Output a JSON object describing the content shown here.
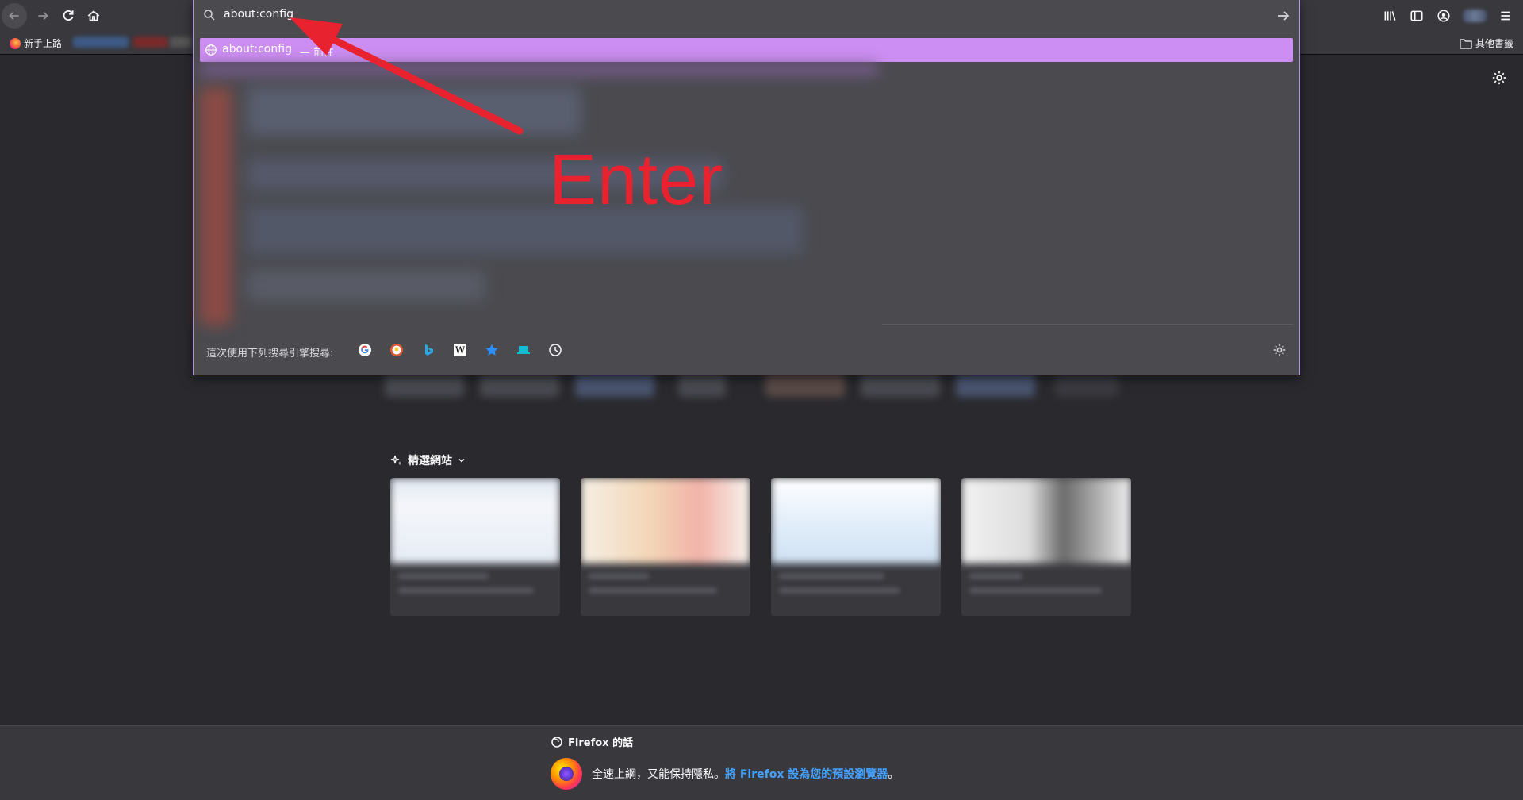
{
  "toolbar": {
    "back_icon": "back-arrow-icon",
    "forward_icon": "forward-arrow-icon",
    "reload_icon": "reload-icon",
    "home_icon": "home-icon",
    "right_icons": [
      "library-icon",
      "sidebar-icon",
      "account-icon",
      "avatar",
      "menu-icon"
    ]
  },
  "bookmarks": {
    "items": [
      {
        "label": "新手上路"
      }
    ],
    "other_label": "其他書籤"
  },
  "urlbar": {
    "value": "about:config",
    "result": {
      "title": "about:config",
      "sub": "— 前往"
    },
    "oneoff_label": "這次使用下列搜尋引擎搜尋:",
    "engines": [
      "google-icon",
      "duckduckgo-icon",
      "bing-icon",
      "wikipedia-icon",
      "bookmarks-star-icon",
      "tabs-icon",
      "history-icon"
    ]
  },
  "annotation": {
    "text": "Enter",
    "color": "#e8222f"
  },
  "newtab": {
    "highlights_title": "精選網站"
  },
  "footer": {
    "heading": "Firefox 的話",
    "message": "全速上網，又能保持隱私。",
    "link": "將 Firefox 設為您的預設瀏覽器",
    "trail": "。"
  },
  "colors": {
    "accent": "#cd8ef3",
    "panel_border": "#b693e0",
    "link": "#45a1ff",
    "background": "#2a2a2e"
  }
}
